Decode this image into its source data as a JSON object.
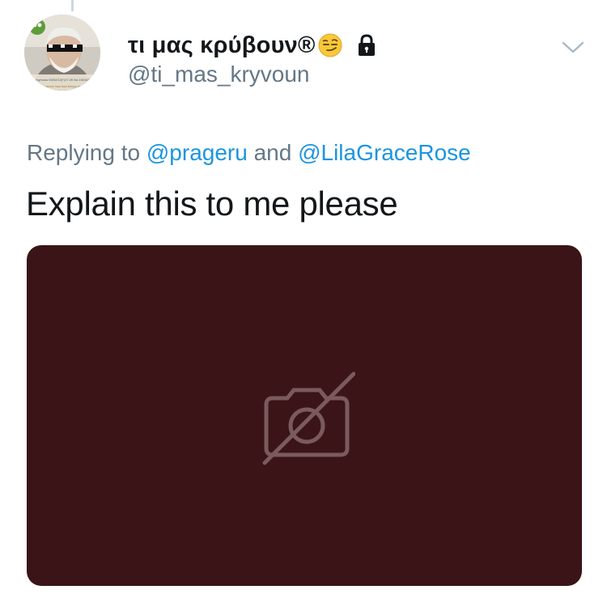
{
  "tweet": {
    "display_name": "τι μας κρύβουν®",
    "handle": "@ti_mas_kryvoun",
    "replying_prefix": "Replying to",
    "replying_to": [
      "@prageru",
      "@LilaGraceRose"
    ],
    "replying_joiner": "and",
    "text": "Explain this to me please",
    "avatar_caption_1": "Anonymous 03/02/12(*)17:29 No.192167",
    "avatar_caption_2": "do you know how bad things are"
  },
  "icons": {
    "emoji": "smirking-face-emoji",
    "protected": "lock-icon",
    "menu": "chevron-down-icon",
    "media": "camera-off-icon"
  },
  "colors": {
    "link": "#1b95e0",
    "secondary_text": "#657786",
    "media_background": "#3b1418"
  }
}
